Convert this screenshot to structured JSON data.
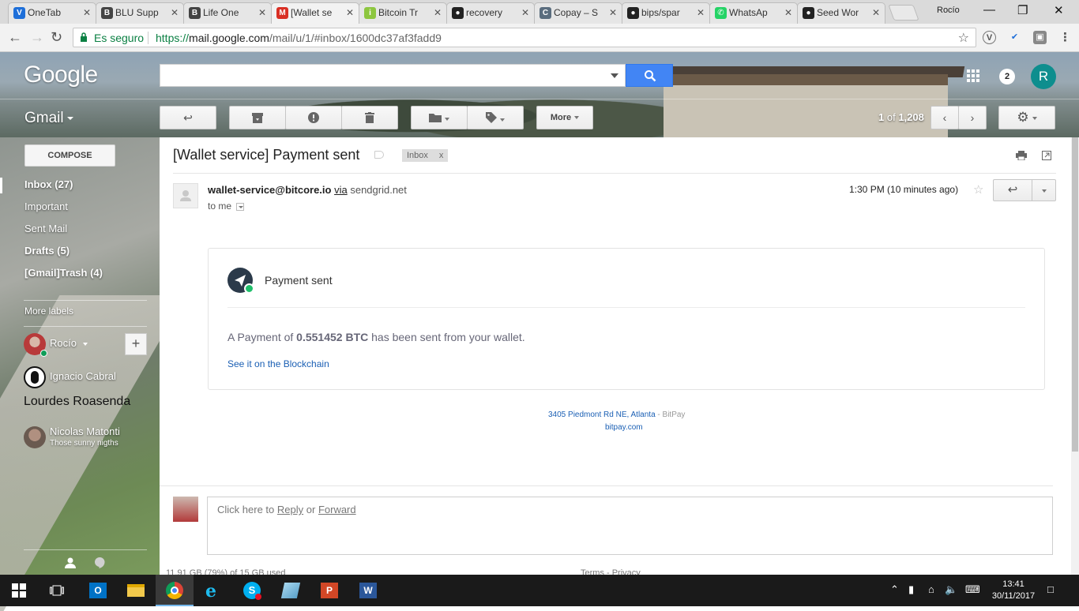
{
  "browser": {
    "tabs": [
      {
        "label": "OneTab",
        "icon": "onetab-icon",
        "color": "#1e6fd9"
      },
      {
        "label": "BLU Supp",
        "icon": "blu-icon",
        "color": "#444444"
      },
      {
        "label": "Life One",
        "icon": "blu-icon",
        "color": "#444444"
      },
      {
        "label": "[Wallet se",
        "icon": "gmail-icon",
        "color": "#d93025",
        "active": true
      },
      {
        "label": "Bitcoin Tr",
        "icon": "info-icon",
        "color": "#8dc63f"
      },
      {
        "label": "recovery",
        "icon": "github-icon",
        "color": "#222222"
      },
      {
        "label": "Copay – S",
        "icon": "copay-icon",
        "color": "#5a6d7e"
      },
      {
        "label": "bips/spar",
        "icon": "github-icon",
        "color": "#222222"
      },
      {
        "label": "WhatsAp",
        "icon": "whatsapp-icon",
        "color": "#25d366"
      },
      {
        "label": "Seed Wor",
        "icon": "github-icon",
        "color": "#222222"
      }
    ],
    "profile_name": "Rocío",
    "secure_label": "Es seguro",
    "url_scheme": "https://",
    "url_host": "mail.google.com",
    "url_path": "/mail/u/1/#inbox/1600dc37af3fadd9"
  },
  "gmail": {
    "logo": "Google",
    "app_label": "Gmail",
    "notification_count": "2",
    "account_initial": "R",
    "more_label": "More",
    "count_range": "1",
    "count_of": "of",
    "count_total": "1,208",
    "compose_label": "COMPOSE",
    "nav": [
      {
        "label": "Inbox (27)",
        "bold": true
      },
      {
        "label": "Important",
        "bold": false
      },
      {
        "label": "Sent Mail",
        "bold": false
      },
      {
        "label": "Drafts (5)",
        "bold": true
      },
      {
        "label": "[Gmail]Trash (4)",
        "bold": true
      }
    ],
    "more_labels": "More labels",
    "hangouts": {
      "me": "Rocío",
      "contacts": [
        {
          "name": "Ignacio Cabral",
          "status": ""
        },
        {
          "name": "Lourdes Roasenda",
          "status": ""
        },
        {
          "name": "Nicolas Matonti",
          "status": "Those sunny nigths"
        }
      ]
    }
  },
  "message": {
    "subject": "[Wallet service] Payment sent",
    "label_chip": "Inbox",
    "label_close": "x",
    "from_email": "wallet-service@bitcore.io",
    "via": "via",
    "via_domain": "sendgrid.net",
    "to": "to me",
    "time": "1:30 PM (10 minutes ago)",
    "card_title": "Payment sent",
    "body_prefix": "A Payment of",
    "amount": "0.551452 BTC",
    "body_suffix": "has been sent from your wallet.",
    "link": "See it on the Blockchain",
    "address": "3405 Piedmont Rd NE, Atlanta",
    "address_sep": " - ",
    "company": "BitPay",
    "site": "bitpay.com"
  },
  "reply": {
    "prefix": "Click here to",
    "reply": "Reply",
    "or": "or",
    "forward": "Forward"
  },
  "footer": {
    "storage": "11.91 GB (79%) of 15 GB used",
    "terms": "Terms - Privacy"
  },
  "taskbar": {
    "time": "13:41",
    "date": "30/11/2017"
  }
}
